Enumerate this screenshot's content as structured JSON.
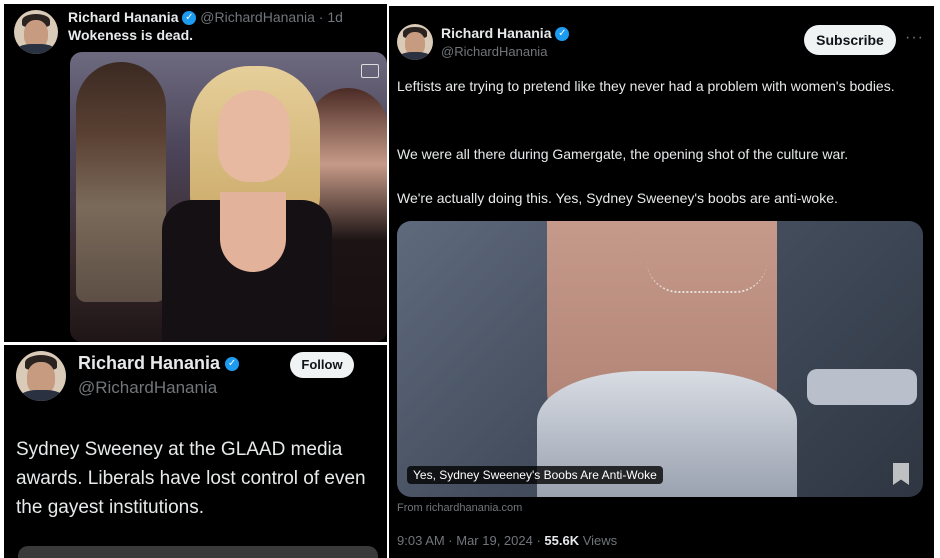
{
  "panel1": {
    "author_name": "Richard Hanania",
    "author_handle": "@RichardHanania",
    "time": "· 1d",
    "text": "Wokeness is dead."
  },
  "panel2": {
    "author_name": "Richard Hanania",
    "author_handle": "@RichardHanania",
    "follow_label": "Follow",
    "text": "Sydney Sweeney at the GLAAD media awards. Liberals have lost control of even the gayest institutions."
  },
  "panel3": {
    "author_name": "Richard Hanania",
    "author_handle": "@RichardHanania",
    "subscribe_label": "Subscribe",
    "more_label": "···",
    "paragraphs": [
      "Leftists are trying to pretend like they never had a problem with women's bodies.",
      "We were all there during Gamergate, the opening shot of the culture war.",
      "We're actually doing this. Yes, Sydney Sweeney's boobs are anti-woke."
    ],
    "card_title": "Yes, Sydney Sweeney's Boobs Are Anti-Woke",
    "card_source": "From richardhanania.com",
    "timestamp": "9:03 AM · Mar 19, 2024 · ",
    "views_count": "55.6K",
    "views_label": " Views"
  },
  "colors": {
    "background": "#000000",
    "text": "#e7e9ea",
    "muted": "#71767b",
    "verified": "#1d9bf0",
    "button": "#eff3f4"
  },
  "icons": [
    "verified-badge-icon",
    "gif-icon",
    "bookmark-icon",
    "more-icon"
  ]
}
